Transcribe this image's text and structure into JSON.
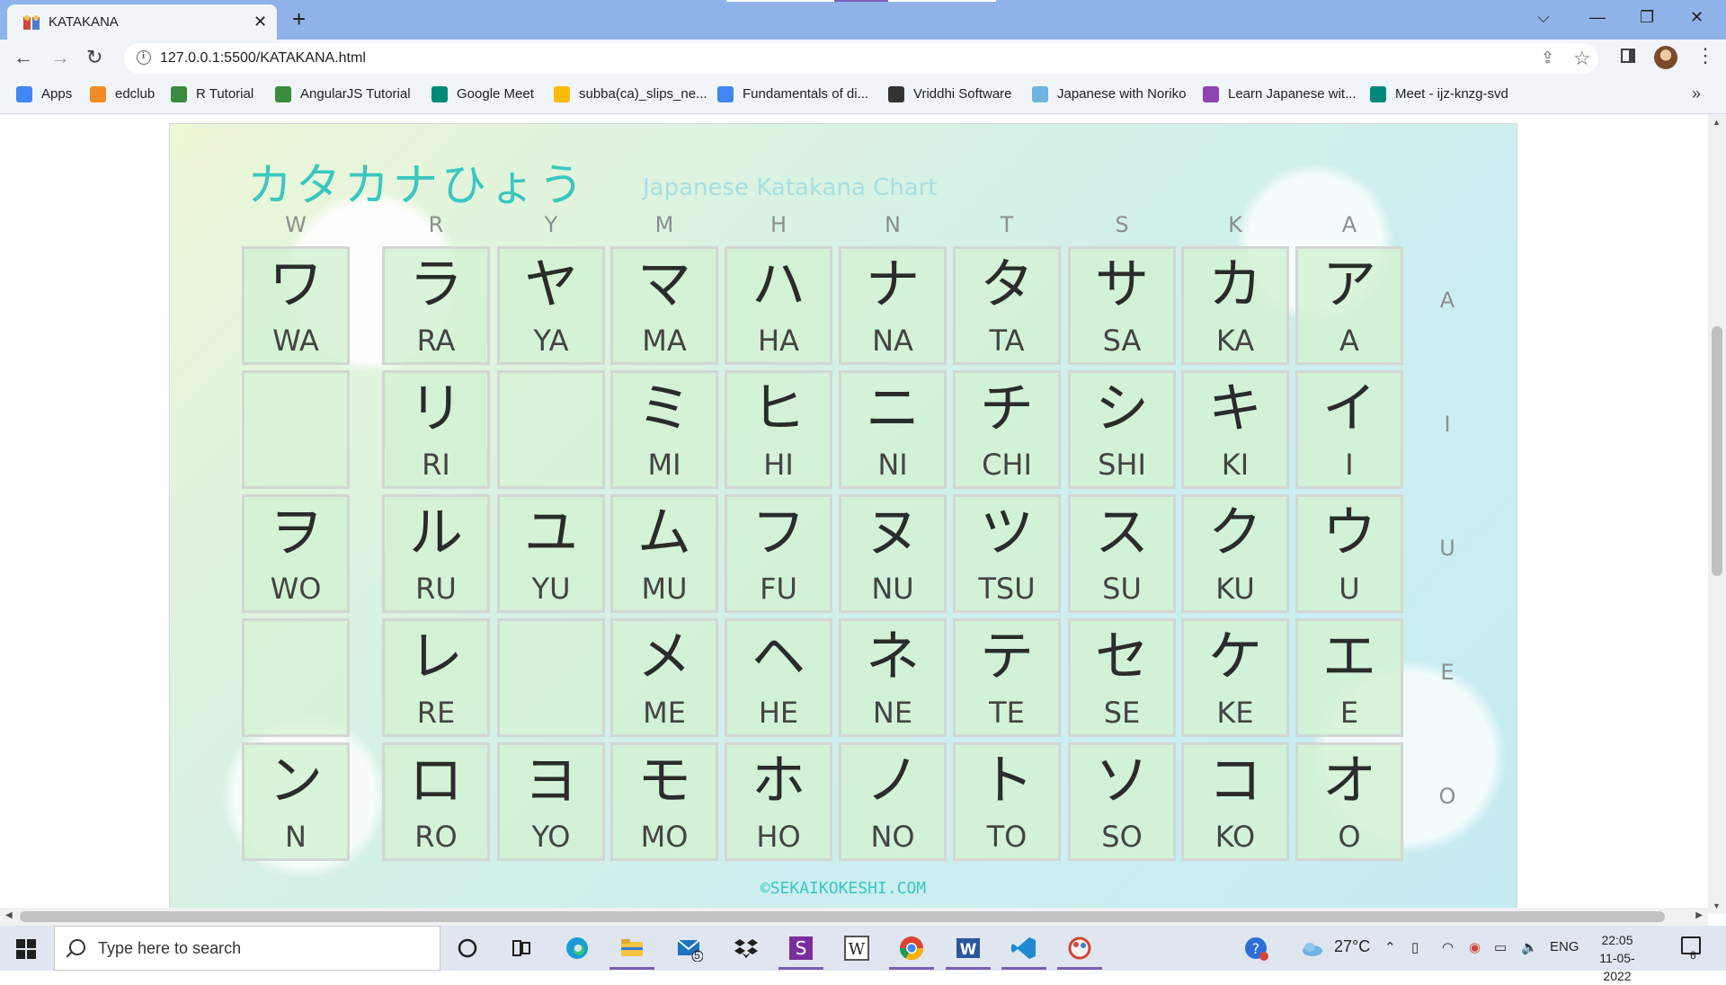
{
  "browser": {
    "tab_title": "KATAKANA",
    "url": "127.0.0.1:5500/KATAKANA.html",
    "bookmarks": [
      {
        "label": "Apps",
        "icon": "apps-grid-icon",
        "color": "#4285f4"
      },
      {
        "label": "edclub",
        "icon": "edclub-icon",
        "color": "#f28b25"
      },
      {
        "label": "R Tutorial",
        "icon": "w3-icon",
        "color": "#3b8a3e"
      },
      {
        "label": "AngularJS Tutorial",
        "icon": "w3-icon",
        "color": "#3b8a3e"
      },
      {
        "label": "Google Meet",
        "icon": "google-meet-icon",
        "color": "#00897b"
      },
      {
        "label": "subba(ca)_slips_ne...",
        "icon": "google-drive-icon",
        "color": "#fbbc04"
      },
      {
        "label": "Fundamentals of di...",
        "icon": "google-icon",
        "color": "#4285f4"
      },
      {
        "label": "Vriddhi Software",
        "icon": "globe-icon",
        "color": "#333333"
      },
      {
        "label": "Japanese with Noriko",
        "icon": "noriko-icon",
        "color": "#6fb3e0"
      },
      {
        "label": "Learn Japanese wit...",
        "icon": "podcast-icon",
        "color": "#8e44ad"
      },
      {
        "label": "Meet - ijz-knzg-svd",
        "icon": "google-meet-icon",
        "color": "#00897b"
      }
    ]
  },
  "chart": {
    "title": "カタカナひょう",
    "subtitle": "Japanese Katakana Chart",
    "credit": "©SEKAIKOKESHI.COM",
    "columns": [
      "W",
      "R",
      "Y",
      "M",
      "H",
      "N",
      "T",
      "S",
      "K",
      "A"
    ],
    "rows": [
      "A",
      "I",
      "U",
      "E",
      "O"
    ],
    "cells": [
      [
        {
          "k": "ワ",
          "r": "WA"
        },
        {
          "k": "ラ",
          "r": "RA"
        },
        {
          "k": "ヤ",
          "r": "YA"
        },
        {
          "k": "マ",
          "r": "MA"
        },
        {
          "k": "ハ",
          "r": "HA"
        },
        {
          "k": "ナ",
          "r": "NA"
        },
        {
          "k": "タ",
          "r": "TA"
        },
        {
          "k": "サ",
          "r": "SA"
        },
        {
          "k": "カ",
          "r": "KA"
        },
        {
          "k": "ア",
          "r": "A"
        }
      ],
      [
        {
          "k": "",
          "r": ""
        },
        {
          "k": "リ",
          "r": "RI"
        },
        {
          "k": "",
          "r": ""
        },
        {
          "k": "ミ",
          "r": "MI"
        },
        {
          "k": "ヒ",
          "r": "HI"
        },
        {
          "k": "ニ",
          "r": "NI"
        },
        {
          "k": "チ",
          "r": "CHI"
        },
        {
          "k": "シ",
          "r": "SHI"
        },
        {
          "k": "キ",
          "r": "KI"
        },
        {
          "k": "イ",
          "r": "I"
        }
      ],
      [
        {
          "k": "ヲ",
          "r": "WO"
        },
        {
          "k": "ル",
          "r": "RU"
        },
        {
          "k": "ユ",
          "r": "YU"
        },
        {
          "k": "ム",
          "r": "MU"
        },
        {
          "k": "フ",
          "r": "FU"
        },
        {
          "k": "ヌ",
          "r": "NU"
        },
        {
          "k": "ツ",
          "r": "TSU"
        },
        {
          "k": "ス",
          "r": "SU"
        },
        {
          "k": "ク",
          "r": "KU"
        },
        {
          "k": "ウ",
          "r": "U"
        }
      ],
      [
        {
          "k": "",
          "r": ""
        },
        {
          "k": "レ",
          "r": "RE"
        },
        {
          "k": "",
          "r": ""
        },
        {
          "k": "メ",
          "r": "ME"
        },
        {
          "k": "ヘ",
          "r": "HE"
        },
        {
          "k": "ネ",
          "r": "NE"
        },
        {
          "k": "テ",
          "r": "TE"
        },
        {
          "k": "セ",
          "r": "SE"
        },
        {
          "k": "ケ",
          "r": "KE"
        },
        {
          "k": "エ",
          "r": "E"
        }
      ],
      [
        {
          "k": "ン",
          "r": "N"
        },
        {
          "k": "ロ",
          "r": "RO"
        },
        {
          "k": "ヨ",
          "r": "YO"
        },
        {
          "k": "モ",
          "r": "MO"
        },
        {
          "k": "ホ",
          "r": "HO"
        },
        {
          "k": "ノ",
          "r": "NO"
        },
        {
          "k": "ト",
          "r": "TO"
        },
        {
          "k": "ソ",
          "r": "SO"
        },
        {
          "k": "コ",
          "r": "KO"
        },
        {
          "k": "オ",
          "r": "O"
        }
      ]
    ]
  },
  "taskbar": {
    "search_placeholder": "Type here to search",
    "mail_badge": "5",
    "weather": "27°C",
    "language": "ENG",
    "time": "22:05",
    "date": "11-05-2022",
    "notification_count": "6"
  }
}
